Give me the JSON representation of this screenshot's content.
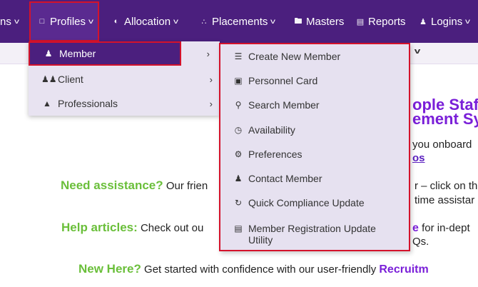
{
  "nav": {
    "partial_item": "ns",
    "profiles": "Profiles",
    "allocation": "Allocation",
    "placements": "Placements",
    "masters": "Masters",
    "reports": "Reports",
    "logins": "Logins"
  },
  "profiles_menu": {
    "items": [
      {
        "label": "Member",
        "icon": "user-icon",
        "active": true
      },
      {
        "label": "Client",
        "icon": "users-icon",
        "active": false
      },
      {
        "label": "Professionals",
        "icon": "graduation-cap-icon",
        "active": false
      }
    ]
  },
  "member_submenu": {
    "items": [
      {
        "label": "Create New Member",
        "icon": "checklist-icon"
      },
      {
        "label": "Personnel Card",
        "icon": "image-icon"
      },
      {
        "label": "Search Member",
        "icon": "search-icon"
      },
      {
        "label": "Availability",
        "icon": "clock-icon"
      },
      {
        "label": "Preferences",
        "icon": "gear-icon"
      },
      {
        "label": "Contact Member",
        "icon": "person-icon"
      },
      {
        "label": "Quick Compliance Update",
        "icon": "refresh-icon"
      },
      {
        "label": "Member Registration Update Utility",
        "icon": "document-icon"
      }
    ]
  },
  "content": {
    "title_line1": "ople Staf",
    "title_line2": "ement Sy",
    "onboard_text": "you onboard",
    "onboard_link": "os",
    "need_assistance_label": "Need assistance?",
    "need_assistance_text": "Our frien",
    "need_assistance_right": "r – click on th",
    "need_assistance_right2": "time assistar",
    "help_label": "Help articles:",
    "help_text": "Check out ou",
    "help_link": "e",
    "help_right": "for in-dept",
    "help_right2": "Qs.",
    "new_here_label": "New Here?",
    "new_here_text": "Get started with confidence with our user-friendly",
    "new_here_link": "Recruitm"
  },
  "colors": {
    "nav_bg": "#4b1f7e",
    "highlight_border": "#d4122b",
    "green": "#6abf3a",
    "purple": "#7a1fd8",
    "menu_bg": "#e8e3f1"
  }
}
